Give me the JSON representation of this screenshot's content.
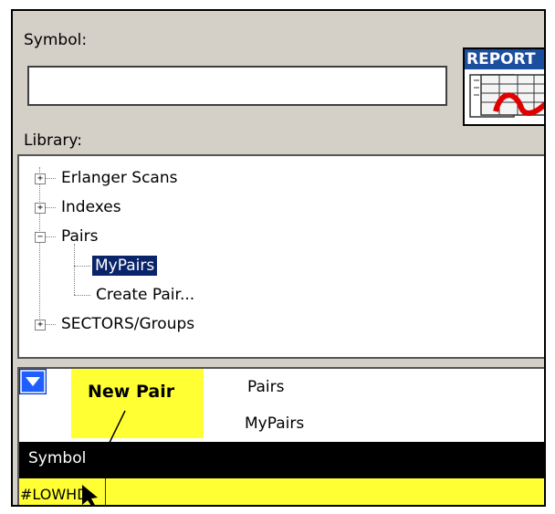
{
  "symbol": {
    "label": "Symbol:",
    "value": ""
  },
  "report": {
    "label": "REPORT",
    "icon": "report-grid-icon"
  },
  "library": {
    "label": "Library:",
    "tree": [
      {
        "label": "Erlanger Scans",
        "expander": "+"
      },
      {
        "label": "Indexes",
        "expander": "+"
      },
      {
        "label": "Pairs",
        "expander": "−",
        "children": [
          {
            "label": "MyPairs",
            "selected": true
          },
          {
            "label": "Create Pair..."
          }
        ]
      },
      {
        "label": "SECTORS/Groups",
        "expander": "+"
      }
    ]
  },
  "grid": {
    "dropdown_icon": "dropdown-arrow-icon",
    "annotation": "New Pair",
    "title_line1": "Pairs",
    "title_line2": "MyPairs",
    "column_header": "Symbol",
    "row_value": "#LOWHD",
    "highlight_color": "#ffff33"
  }
}
